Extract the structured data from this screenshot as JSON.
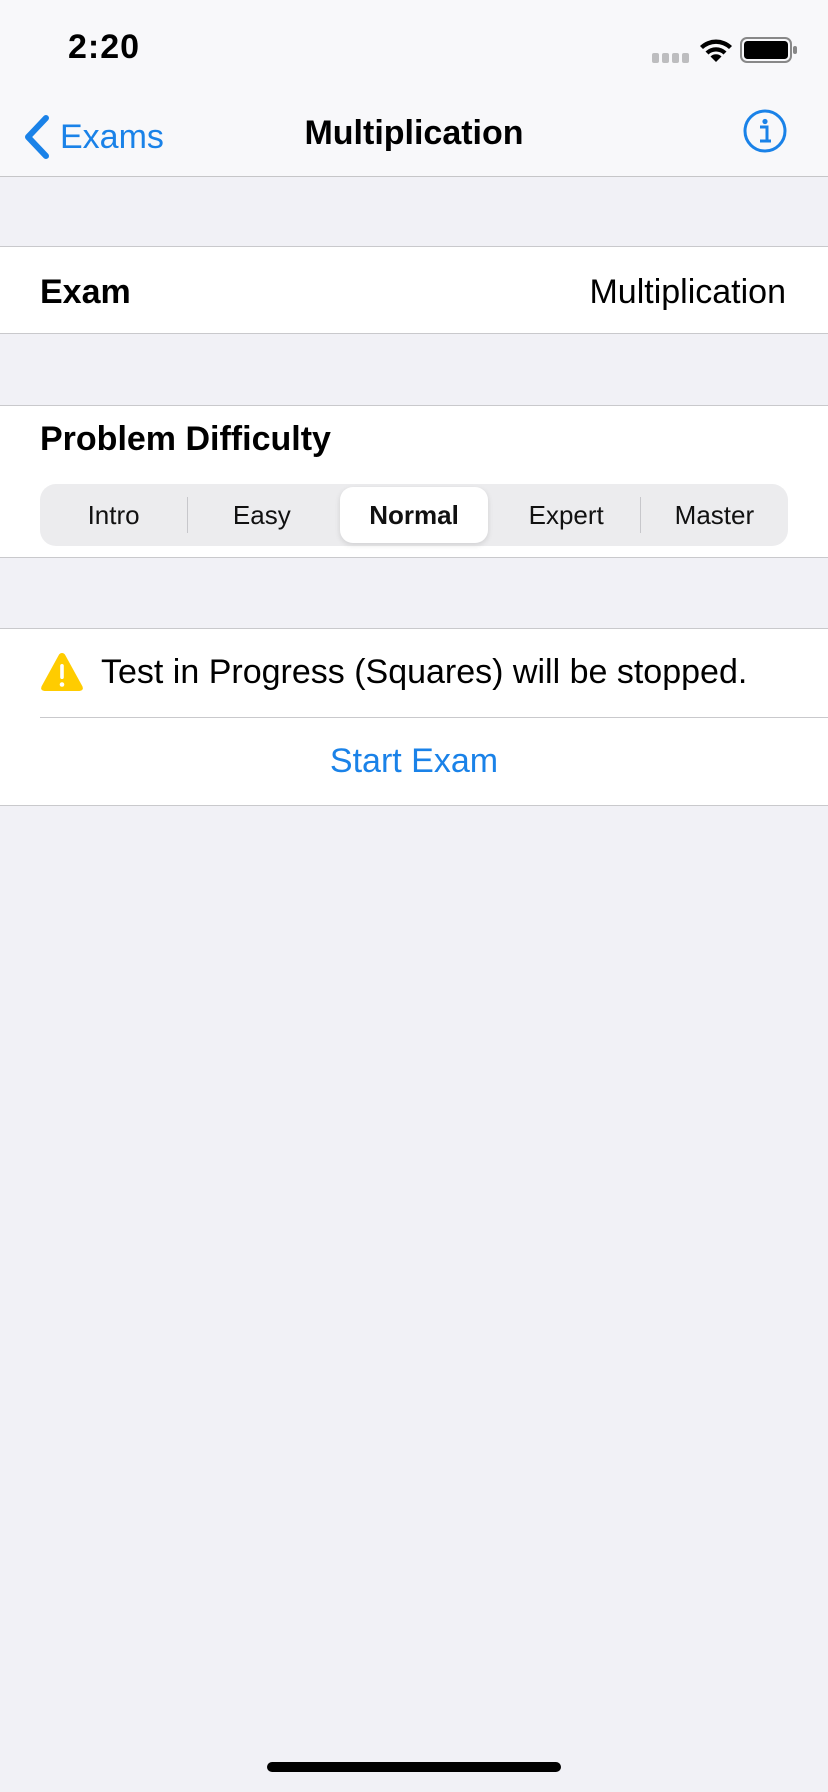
{
  "status_bar": {
    "time": "2:20",
    "icons": [
      "cellular-signal-icon",
      "wifi-icon",
      "battery-icon"
    ]
  },
  "nav": {
    "back_label": "Exams",
    "title": "Multiplication",
    "info_icon": "info-icon"
  },
  "exam_row": {
    "label": "Exam",
    "value": "Multiplication"
  },
  "difficulty": {
    "heading": "Problem Difficulty",
    "segments": [
      "Intro",
      "Easy",
      "Normal",
      "Expert",
      "Master"
    ],
    "selected": "Normal"
  },
  "start_section": {
    "warning_icon": "warning-icon",
    "warning_text": "Test in Progress (Squares) will be stopped.",
    "start_label": "Start Exam"
  },
  "colors": {
    "accent": "#1a82e8",
    "warning": "#ffcc00",
    "background": "#f1f1f6"
  }
}
